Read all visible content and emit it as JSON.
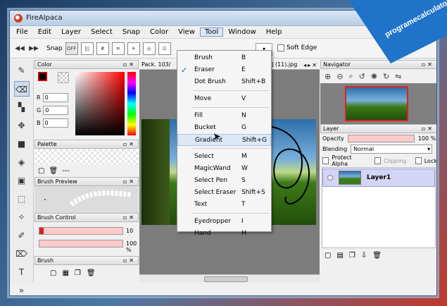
{
  "window": {
    "title": "FireAlpaca"
  },
  "menubar": [
    "File",
    "Edit",
    "Layer",
    "Select",
    "Snap",
    "Color",
    "View",
    "Tool",
    "Window",
    "Help"
  ],
  "toolbar": {
    "snap_label": "Snap",
    "combo_value": "▾",
    "soft_edge": "Soft Edge"
  },
  "color_panel": {
    "title": "Color",
    "r": "0",
    "g": "0",
    "b": "0",
    "r_label": "R",
    "g_label": "G",
    "b_label": "B"
  },
  "palette_panel": {
    "title": "Palette",
    "extra": "---"
  },
  "brush_preview": {
    "title": "Brush Preview"
  },
  "brush_control": {
    "title": "Brush Control",
    "size": "10",
    "opacity": "100 %",
    "size_fraction": 0.05
  },
  "brush_panel": {
    "title": "Brush"
  },
  "document": {
    "tab_prefix": "Pack. 103/",
    "tab_suffix": "915] (11).jpg"
  },
  "navigator": {
    "title": "Navigator"
  },
  "layer_panel": {
    "title": "Layer",
    "opacity_label": "Opacity",
    "opacity_value": "100 %",
    "blending_label": "Blending",
    "blending_value": "Normal",
    "protect_alpha": "Protect Alpha",
    "clipping": "Clipping",
    "lock": "Lock",
    "layer_name": "Layer1"
  },
  "tool_menu": [
    {
      "label": "Brush",
      "key": "B",
      "checked": false
    },
    {
      "label": "Eraser",
      "key": "E",
      "checked": true
    },
    {
      "label": "Dot Brush",
      "key": "Shift+B",
      "checked": false
    },
    {
      "label": "Move",
      "key": "V",
      "checked": false
    },
    {
      "label": "Fill",
      "key": "N",
      "checked": false
    },
    {
      "label": "Bucket",
      "key": "G",
      "checked": false
    },
    {
      "label": "Gradient",
      "key": "Shift+G",
      "checked": false,
      "highlighted": true
    },
    {
      "label": "Select",
      "key": "M",
      "checked": false
    },
    {
      "label": "MagicWand",
      "key": "W",
      "checked": false
    },
    {
      "label": "Select Pen",
      "key": "S",
      "checked": false
    },
    {
      "label": "Select Eraser",
      "key": "Shift+S",
      "checked": false
    },
    {
      "label": "Text",
      "key": "T",
      "checked": false
    },
    {
      "label": "Eyedropper",
      "key": "I",
      "checked": false
    },
    {
      "label": "Hand",
      "key": "H",
      "checked": false
    }
  ],
  "watermark": {
    "text": "programecalculator.ro",
    "colors": {
      "ribbon": "#1f73c8"
    }
  },
  "colors": {
    "accent_red": "#e02020",
    "highlight": "#dce8f6",
    "layer_row": "#d4d4f6"
  }
}
